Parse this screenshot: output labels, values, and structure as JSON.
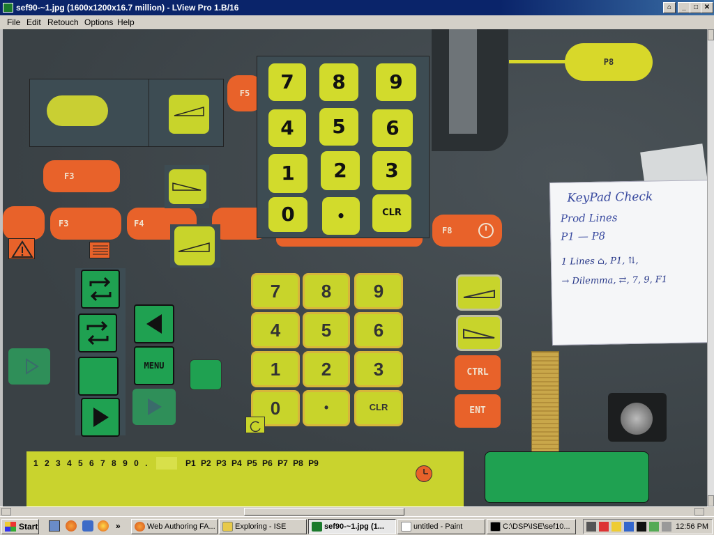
{
  "window": {
    "title": "sef90-~1.jpg (1600x1200x16.7 million) - LView Pro 1.B/16",
    "controls": {
      "pin": "⌂",
      "minimize": "_",
      "maximize": "□",
      "close": "✕"
    }
  },
  "menu": [
    "File",
    "Edit",
    "Retouch",
    "Options",
    "Help"
  ],
  "overlay_keypad": {
    "rows": [
      [
        "7",
        "8",
        "9"
      ],
      [
        "4",
        "5",
        "6"
      ],
      [
        "1",
        "2",
        "3"
      ],
      [
        "0",
        "•",
        "CLR"
      ]
    ]
  },
  "photo_keypad": {
    "rows": [
      [
        "7",
        "8",
        "9"
      ],
      [
        "4",
        "5",
        "6"
      ],
      [
        "1",
        "2",
        "3"
      ],
      [
        "0",
        "•",
        "CLR"
      ]
    ]
  },
  "side_keys": {
    "ctrl": "CTRL",
    "ent": "ENT"
  },
  "function_keys": {
    "f3a": "F3",
    "f3b": "F3",
    "f4": "F4",
    "f5": "F5",
    "f8": "F8",
    "p8": "P8"
  },
  "menu_key": "MENU",
  "whiteboard": {
    "lines": [
      "KeyPad Check",
      "Prod Lines",
      "P1 — P8",
      "1 Lines ⌂, P1, ⇅,",
      "→ Dilemma, ⇄, 7, 9, F1"
    ]
  },
  "status_strip": {
    "digits": "1 2 3 4 5 6 7 8 9 0 .",
    "pkeys": "P1 P2 P3 P4 P5 P6 P7 P8 P9"
  },
  "taskbar": {
    "start": "Start",
    "quick_launch": [
      "show-desktop-icon",
      "firefox-icon",
      "outlook-icon",
      "media-player-icon"
    ],
    "overflow": "»",
    "tasks": [
      {
        "label": "Web Authoring FA...",
        "icon": "firefox-icon",
        "active": false
      },
      {
        "label": "Exploring - ISE",
        "icon": "folder-icon",
        "active": false
      },
      {
        "label": "sef90-~1.jpg (1...",
        "icon": "lview-icon",
        "active": true
      },
      {
        "label": "untitled - Paint",
        "icon": "paint-icon",
        "active": false
      },
      {
        "label": "C:\\DSP\\ISE\\sef10...",
        "icon": "console-icon",
        "active": false
      }
    ],
    "clock": "12:56 PM"
  },
  "colors": {
    "title_bar": "#0a246a",
    "lime": "#d2db2c",
    "green": "#1fa151",
    "orange": "#e8622a",
    "panel": "#3e4549"
  }
}
